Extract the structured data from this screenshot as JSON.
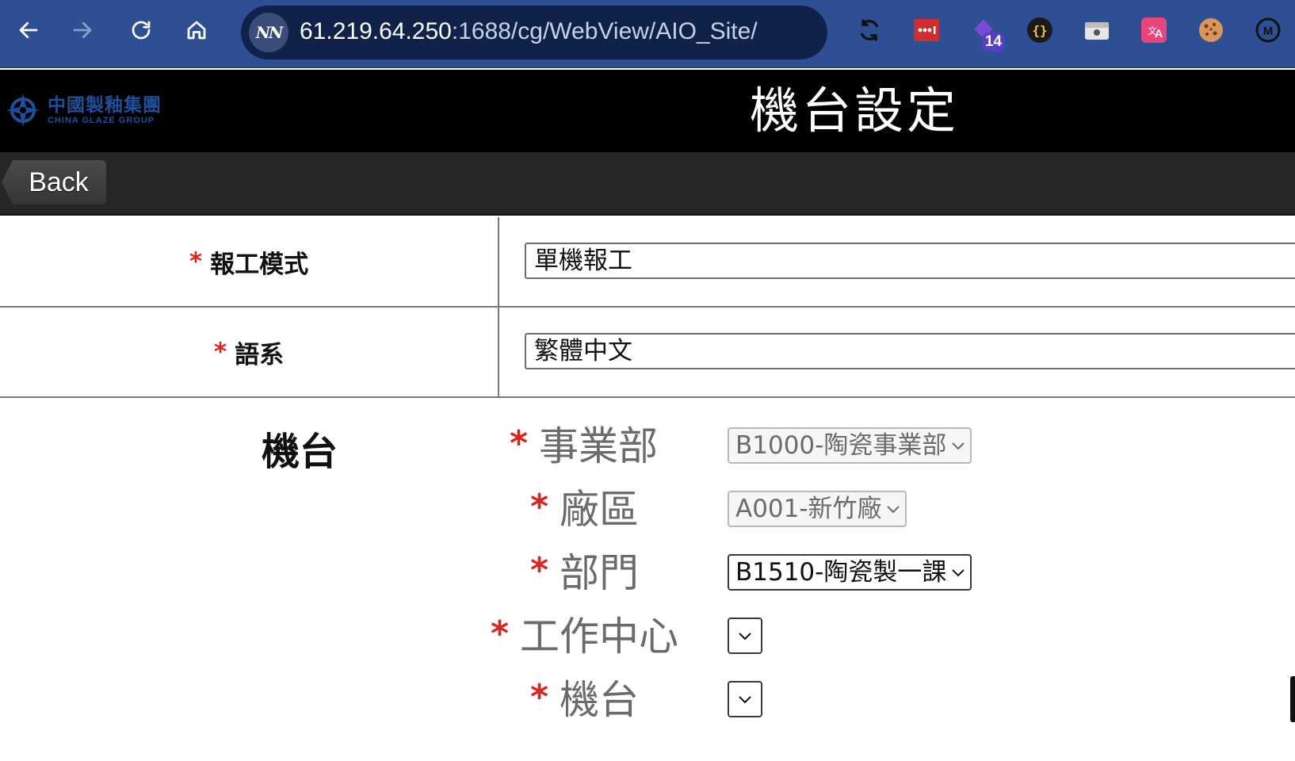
{
  "browser": {
    "url_host": "61.219.64.250",
    "url_path": ":1688/cg/WebView/AIO_Site/",
    "site_badge": "NN",
    "extensions": [
      {
        "name": "sync-icon"
      },
      {
        "name": "password-manager-icon"
      },
      {
        "name": "tag-counter-icon",
        "badge": "14"
      },
      {
        "name": "json-viewer-icon",
        "glyph": "{}"
      },
      {
        "name": "wallet-icon"
      },
      {
        "name": "translate-icon"
      },
      {
        "name": "cookie-icon"
      },
      {
        "name": "metamask-icon"
      }
    ]
  },
  "header": {
    "logo_cn": "中國製釉集團",
    "logo_en": "CHINA GLAZE GROUP",
    "title": "機台設定"
  },
  "toolbar": {
    "back_label": "Back"
  },
  "form": {
    "report_mode": {
      "required_mark": "*",
      "label": "報工模式",
      "value": "單機報工"
    },
    "language": {
      "required_mark": "*",
      "label": "語系",
      "value": "繁體中文"
    }
  },
  "machine": {
    "heading": "機台",
    "fields": {
      "division": {
        "required_mark": "*",
        "label": "事業部",
        "value": "B1000-陶瓷事業部",
        "enabled": false
      },
      "plant": {
        "required_mark": "*",
        "label": "廠區",
        "value": "A001-新竹廠",
        "enabled": false
      },
      "department": {
        "required_mark": "*",
        "label": "部門",
        "value": "B1510-陶瓷製一課",
        "enabled": true
      },
      "work_center": {
        "required_mark": "*",
        "label": "工作中心",
        "value": "",
        "enabled": true
      },
      "machine": {
        "required_mark": "*",
        "label": "機台",
        "value": "",
        "enabled": true
      }
    }
  },
  "colors": {
    "chrome": "#2f4f95",
    "url_bar": "#10224a",
    "header": "#000000",
    "toolbar": "#262626",
    "required": "#d9261c",
    "logo": "#1f4f9c"
  }
}
